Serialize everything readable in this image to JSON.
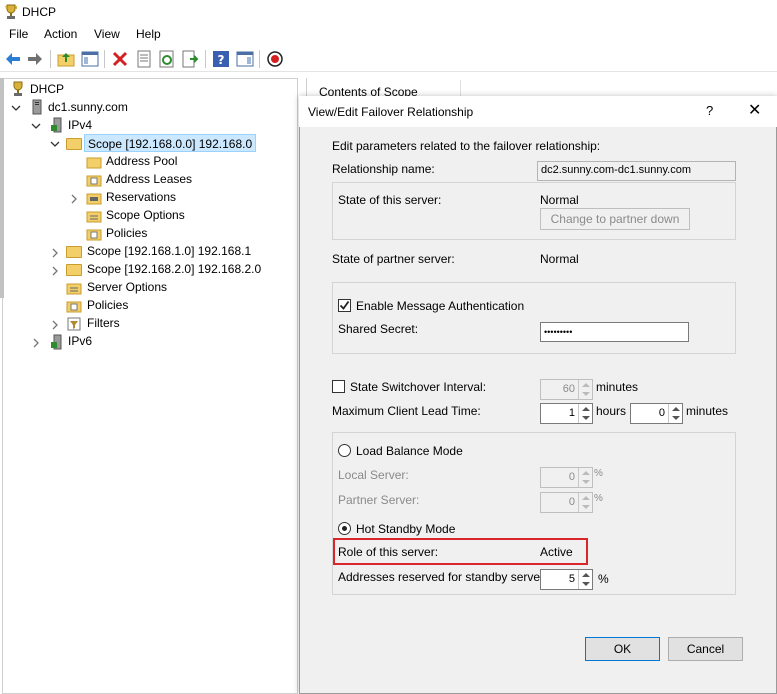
{
  "window": {
    "title": "DHCP",
    "app_icon": "trophy-icon"
  },
  "menu": [
    "File",
    "Action",
    "View",
    "Help"
  ],
  "toolbar": {
    "icons": [
      "back-arrow-icon",
      "forward-arrow-icon",
      "up-folder-icon",
      "show-hide-tree-icon",
      "delete-x-icon",
      "properties-icon",
      "refresh-icon",
      "export-list-icon",
      "help-icon",
      "show-hide-action-pane-icon",
      "stop-service-icon"
    ]
  },
  "tree": {
    "root": "DHCP",
    "server": "dc1.sunny.com",
    "ipv4": "IPv4",
    "scope_selected": "Scope [192.168.0.0] 192.168.0",
    "scope_children": [
      "Address Pool",
      "Address Leases",
      "Reservations",
      "Scope Options",
      "Policies"
    ],
    "scope1": "Scope [192.168.1.0] 192.168.1",
    "scope2": "Scope [192.168.2.0] 192.168.2.0",
    "server_options": "Server Options",
    "policies": "Policies",
    "filters": "Filters",
    "ipv6": "IPv6"
  },
  "contents_header": "Contents of Scope",
  "dialog": {
    "title": "View/Edit Failover Relationship",
    "help": "?",
    "close": "✕",
    "intro": "Edit parameters related to the failover relationship:",
    "relationship_name_label": "Relationship name:",
    "relationship_name_value": "dc2.sunny.com-dc1.sunny.com",
    "state_this_label": "State of this server:",
    "state_this_value": "Normal",
    "partner_down_button": "Change to partner down",
    "state_partner_label": "State of partner server:",
    "state_partner_value": "Normal",
    "enable_auth_label": "Enable Message Authentication",
    "enable_auth_checked": true,
    "shared_secret_label": "Shared Secret:",
    "shared_secret_value": "•••••••••",
    "switchover_label": "State Switchover Interval:",
    "switchover_checked": false,
    "switchover_value": "60",
    "switchover_unit": "minutes",
    "mclt_label": "Maximum Client Lead Time:",
    "mclt_hours": "1",
    "mclt_hours_unit": "hours",
    "mclt_minutes": "0",
    "mclt_minutes_unit": "minutes",
    "load_balance_label": "Load Balance Mode",
    "local_server_label": "Local Server:",
    "local_server_value": "0",
    "partner_server_label": "Partner Server:",
    "partner_server_value": "0",
    "percent": "%",
    "hot_standby_label": "Hot Standby Mode",
    "role_label": "Role of this server:",
    "role_value": "Active",
    "reserved_label": "Addresses reserved for standby server:",
    "reserved_value": "5",
    "ok": "OK",
    "cancel": "Cancel"
  },
  "colors": {
    "highlight": "#d9262b",
    "accent": "#0078d7",
    "selection": "#cce8ff"
  }
}
